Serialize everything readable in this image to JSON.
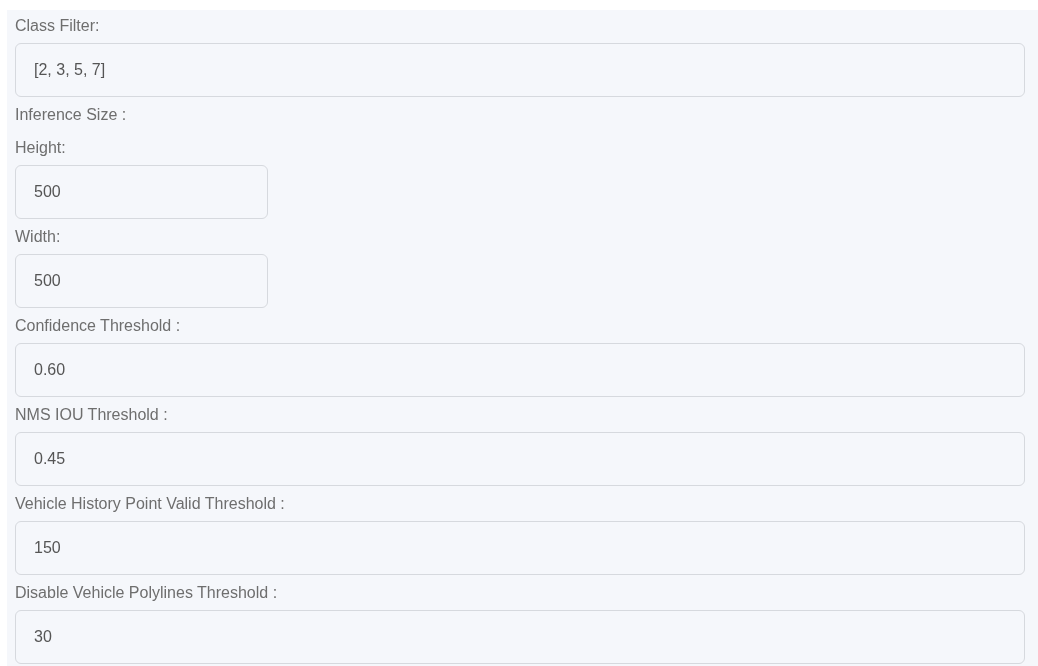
{
  "items": [
    {
      "kind": "wide",
      "label": "Class Filter:",
      "value": "[2, 3, 5, 7]"
    },
    {
      "kind": "caption",
      "label": "Inference Size :"
    },
    {
      "kind": "narrow",
      "label": "Height:",
      "value": "500"
    },
    {
      "kind": "narrow",
      "label": "Width:",
      "value": "500"
    },
    {
      "kind": "wide",
      "label": "Confidence Threshold :",
      "value": "0.60"
    },
    {
      "kind": "wide",
      "label": "NMS IOU Threshold :",
      "value": "0.45"
    },
    {
      "kind": "wide",
      "label": "Vehicle History Point Valid Threshold :",
      "value": "150"
    },
    {
      "kind": "wide",
      "label": "Disable Vehicle Polylines Threshold :",
      "value": "30"
    }
  ]
}
